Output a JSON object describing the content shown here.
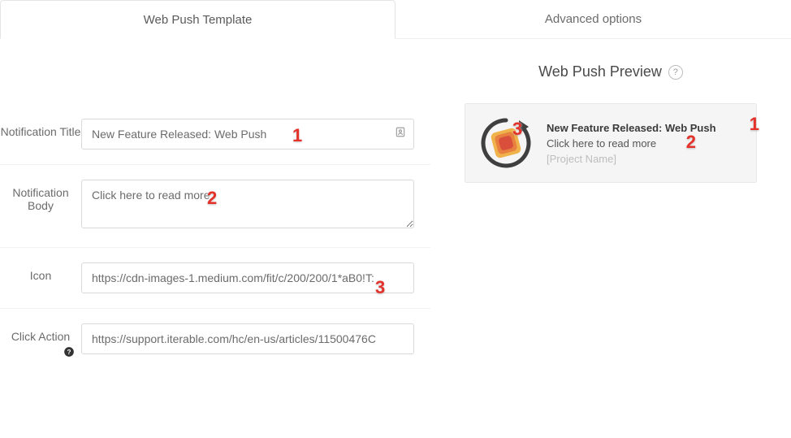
{
  "tabs": {
    "template": "Web Push Template",
    "advanced": "Advanced options"
  },
  "form": {
    "notification_title": {
      "label": "Notification Title",
      "value": "New Feature Released: Web Push"
    },
    "notification_body": {
      "label": "Notification Body",
      "value": "Click here to read more"
    },
    "icon": {
      "label": "Icon",
      "value": "https://cdn-images-1.medium.com/fit/c/200/200/1*aB0!T:"
    },
    "click_action": {
      "label": "Click Action",
      "value": "https://support.iterable.com/hc/en-us/articles/11500476C"
    }
  },
  "preview": {
    "heading": "Web Push Preview",
    "title": "New Feature Released: Web Push",
    "body": "Click here to read more",
    "project": "[Project Name]"
  },
  "callouts": {
    "c1": "1",
    "c2": "2",
    "c3": "3"
  }
}
